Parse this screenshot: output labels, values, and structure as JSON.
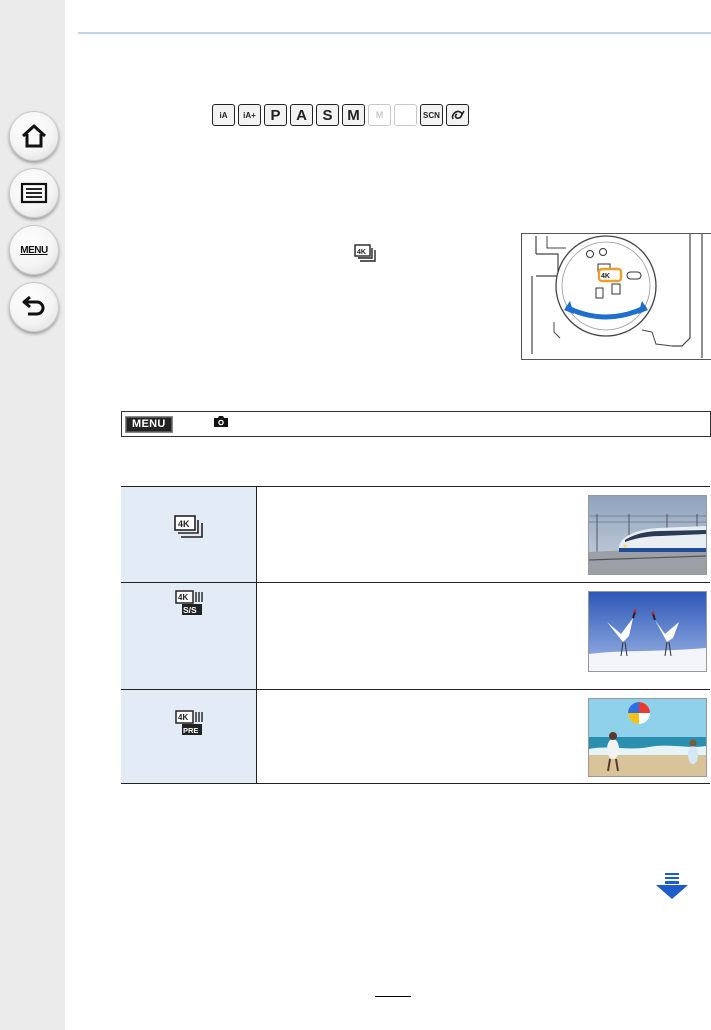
{
  "nav": {
    "items": [
      {
        "name": "home",
        "icon": "home-icon"
      },
      {
        "name": "contents",
        "icon": "list-icon"
      },
      {
        "name": "menu",
        "icon": "menu-icon",
        "label": "MENU"
      },
      {
        "name": "back",
        "icon": "back-arrow-icon"
      }
    ]
  },
  "modes": {
    "chips": [
      "iA",
      "iA+",
      "P",
      "A",
      "S",
      "M",
      "M",
      "",
      "SCN",
      ""
    ]
  },
  "menu_path": {
    "badge": "MENU",
    "camera_icon": "camera-icon"
  },
  "options": [
    {
      "icon": "4k-burst-icon",
      "thumb": "bullet-train-photo"
    },
    {
      "icon": "4k-burst-start-stop-icon",
      "thumb": "cranes-photo"
    },
    {
      "icon": "4k-pre-burst-icon",
      "thumb": "beach-ball-photo"
    }
  ],
  "colors": {
    "sidebar": "#ebebeb",
    "table_icon_cell": "#e3ebf7",
    "accent_rule": "#c4d4ea",
    "next_arrow": "#1e5cc8",
    "dial_highlight": "#e8a02a"
  }
}
